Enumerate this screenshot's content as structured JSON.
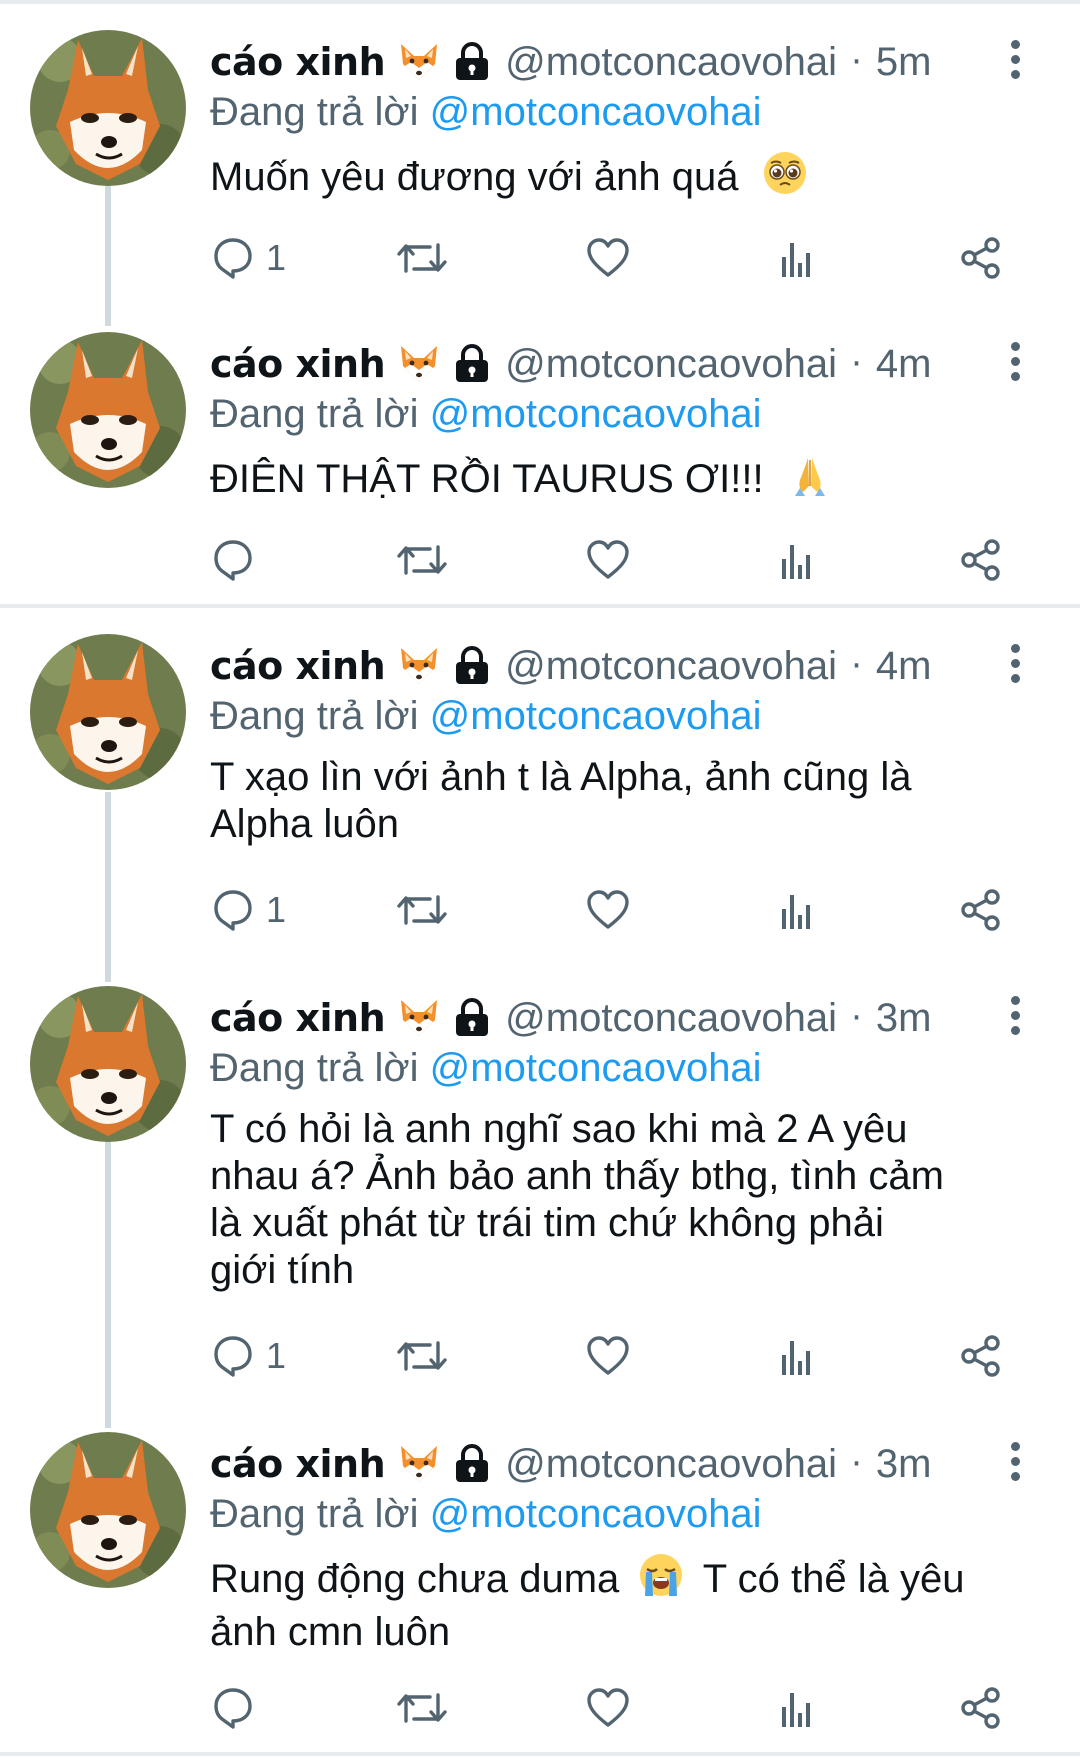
{
  "tweets": [
    {
      "name": "cáo xinh",
      "handle": "@motconcaovohai",
      "separator": "·",
      "time": "5m",
      "reply_prefix": "Đang trả lời",
      "reply_to": "@motconcaovohai",
      "text_lines": [
        "Muốn yêu đương với ảnh quá"
      ],
      "emoji": "pleading-face",
      "reply_count": "1"
    },
    {
      "name": "cáo xinh",
      "handle": "@motconcaovohai",
      "separator": "·",
      "time": "4m",
      "reply_prefix": "Đang trả lời",
      "reply_to": "@motconcaovohai",
      "text_lines": [
        "ĐIÊN THẬT RỒI TAURUS ƠI!!!"
      ],
      "emoji": "folded-hands",
      "reply_count": ""
    },
    {
      "name": "cáo xinh",
      "handle": "@motconcaovohai",
      "separator": "·",
      "time": "4m",
      "reply_prefix": "Đang trả lời",
      "reply_to": "@motconcaovohai",
      "text_lines": [
        "T xạo lìn với ảnh t là Alpha, ảnh cũng là",
        "Alpha luôn"
      ],
      "emoji": "",
      "reply_count": "1"
    },
    {
      "name": "cáo xinh",
      "handle": "@motconcaovohai",
      "separator": "·",
      "time": "3m",
      "reply_prefix": "Đang trả lời",
      "reply_to": "@motconcaovohai",
      "text_lines": [
        "T có hỏi là anh nghĩ sao khi mà 2 A yêu",
        "nhau á? Ảnh bảo anh thấy bthg, tình cảm",
        "là xuất phát từ trái tim chứ không phải",
        "giới tính"
      ],
      "emoji": "",
      "reply_count": "1"
    },
    {
      "name": "cáo xinh",
      "handle": "@motconcaovohai",
      "separator": "·",
      "time": "3m",
      "reply_prefix": "Đang trả lời",
      "reply_to": "@motconcaovohai",
      "text_line1_a": "Rung động chưa duma",
      "text_line1_b": "T có thể là yêu",
      "text_line2": "ảnh cmn luôn",
      "emoji": "loudly-crying-face",
      "reply_count": ""
    }
  ],
  "badges": {
    "name_emoji": "fox-face",
    "lock_icon": "lock-icon"
  },
  "colors": {
    "accent": "#1d9bf0",
    "secondary_text": "#536471",
    "primary_text": "#0f1419",
    "thread_line": "#cfd9de"
  },
  "icons": [
    "reply-icon",
    "retweet-icon",
    "like-icon",
    "views-icon",
    "share-icon",
    "more-icon"
  ]
}
